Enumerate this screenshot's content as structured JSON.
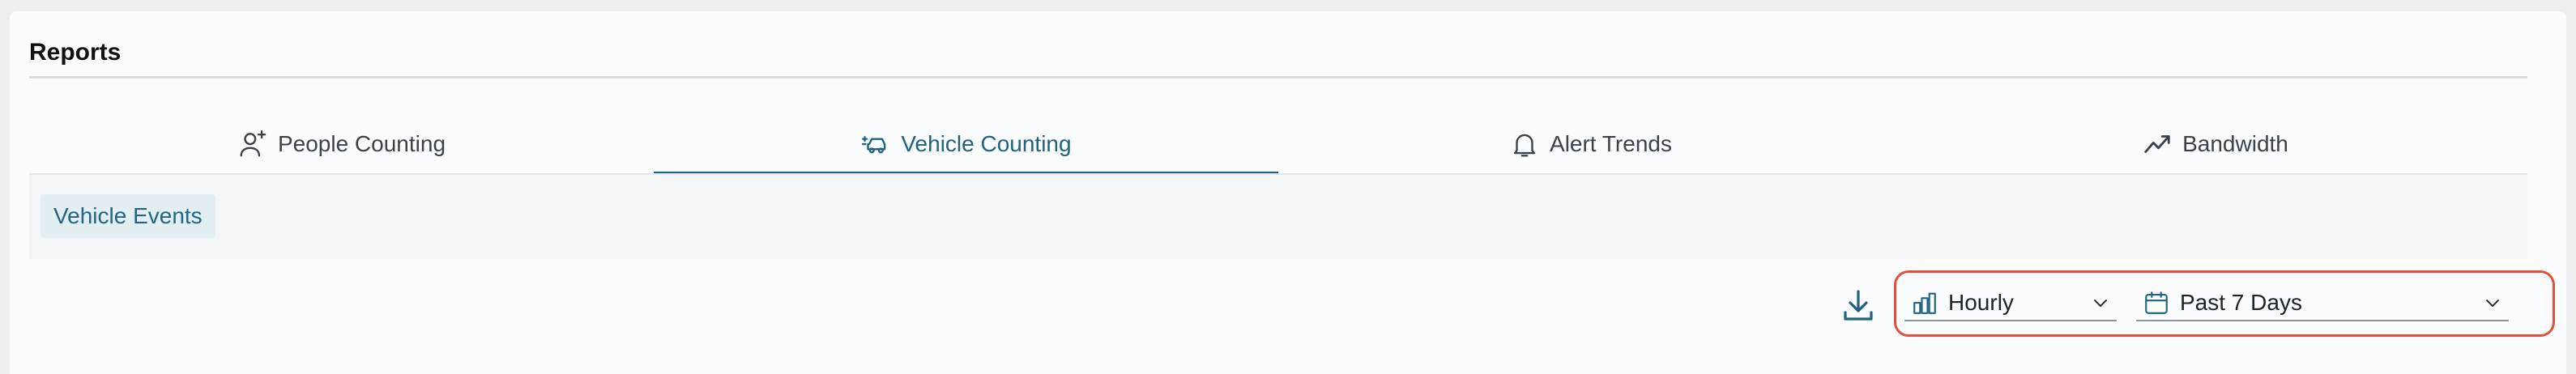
{
  "page": {
    "title": "Reports"
  },
  "tabs": [
    {
      "label": "People Counting",
      "icon": "person-add-icon",
      "active": false
    },
    {
      "label": "Vehicle Counting",
      "icon": "vehicle-icon",
      "active": true
    },
    {
      "label": "Alert Trends",
      "icon": "bell-icon",
      "active": false
    },
    {
      "label": "Bandwidth",
      "icon": "trend-line-icon",
      "active": false
    }
  ],
  "subtabs": [
    {
      "label": "Vehicle Events",
      "active": true
    }
  ],
  "toolbar": {
    "download_icon": "download-icon",
    "interval": {
      "value": "Hourly",
      "icon": "bar-chart-icon"
    },
    "date_range": {
      "value": "Past 7 Days",
      "icon": "calendar-icon"
    }
  },
  "colors": {
    "accent": "#1f6281",
    "highlight": "#e1503a",
    "chip_bg": "#e2eef2"
  }
}
